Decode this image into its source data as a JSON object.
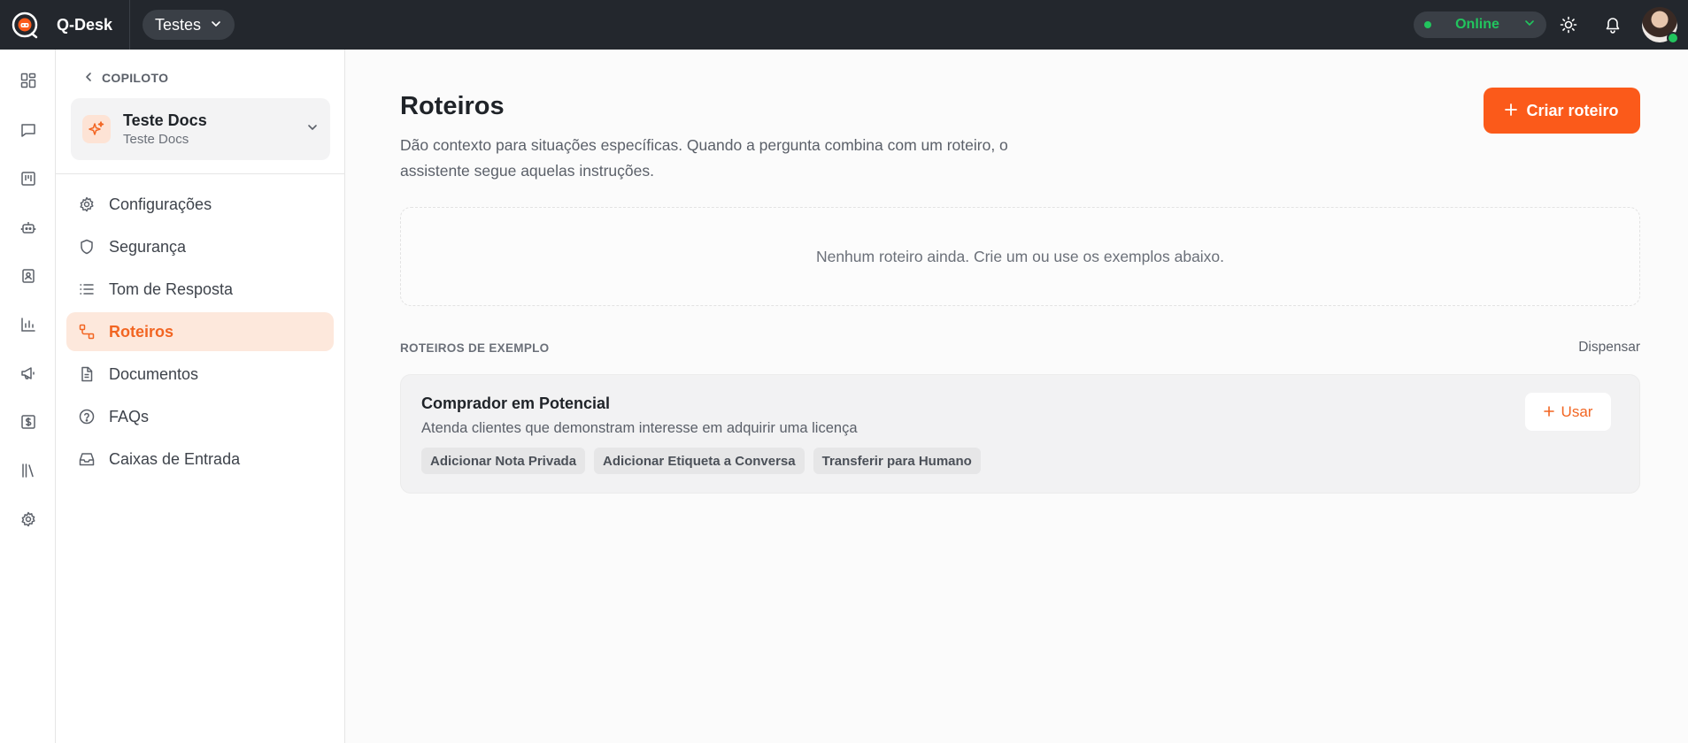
{
  "app": {
    "name": "Q-Desk"
  },
  "topbar": {
    "workspace": "Testes",
    "status": "Online",
    "icons": [
      "theme-toggle-icon",
      "bell-icon"
    ]
  },
  "rail": {
    "icons": [
      "dashboard-icon",
      "conversations-icon",
      "kanban-icon",
      "bot-icon",
      "contacts-icon",
      "reports-icon",
      "campaigns-icon",
      "billing-icon",
      "library-icon",
      "settings-icon"
    ]
  },
  "sidebar": {
    "back_label": "COPILOTO",
    "assistant": {
      "name": "Teste Docs",
      "subtitle": "Teste Docs"
    },
    "items": [
      {
        "label": "Configurações",
        "icon": "gear-icon"
      },
      {
        "label": "Segurança",
        "icon": "shield-icon"
      },
      {
        "label": "Tom de Resposta",
        "icon": "list-icon"
      },
      {
        "label": "Roteiros",
        "icon": "route-icon",
        "active": true
      },
      {
        "label": "Documentos",
        "icon": "document-icon"
      },
      {
        "label": "FAQs",
        "icon": "question-icon"
      },
      {
        "label": "Caixas de Entrada",
        "icon": "inbox-icon"
      }
    ]
  },
  "main": {
    "title": "Roteiros",
    "description": "Dão contexto para situações específicas. Quando a pergunta combina com um roteiro, o assistente segue aquelas instruções.",
    "create_label": "Criar roteiro",
    "empty_text": "Nenhum roteiro ainda. Crie um ou use os exemplos abaixo.",
    "examples_label": "ROTEIROS DE EXEMPLO",
    "dismiss_label": "Dispensar",
    "example": {
      "title": "Comprador em Potencial",
      "description": "Atenda clientes que demonstram interesse em adquirir uma licença",
      "tags": [
        "Adicionar Nota Privada",
        "Adicionar Etiqueta a Conversa",
        "Transferir para Humano"
      ],
      "use_label": "Usar"
    }
  },
  "colors": {
    "accent": "#fb5a1a",
    "topbar": "#23272d",
    "online": "#22c55e"
  }
}
